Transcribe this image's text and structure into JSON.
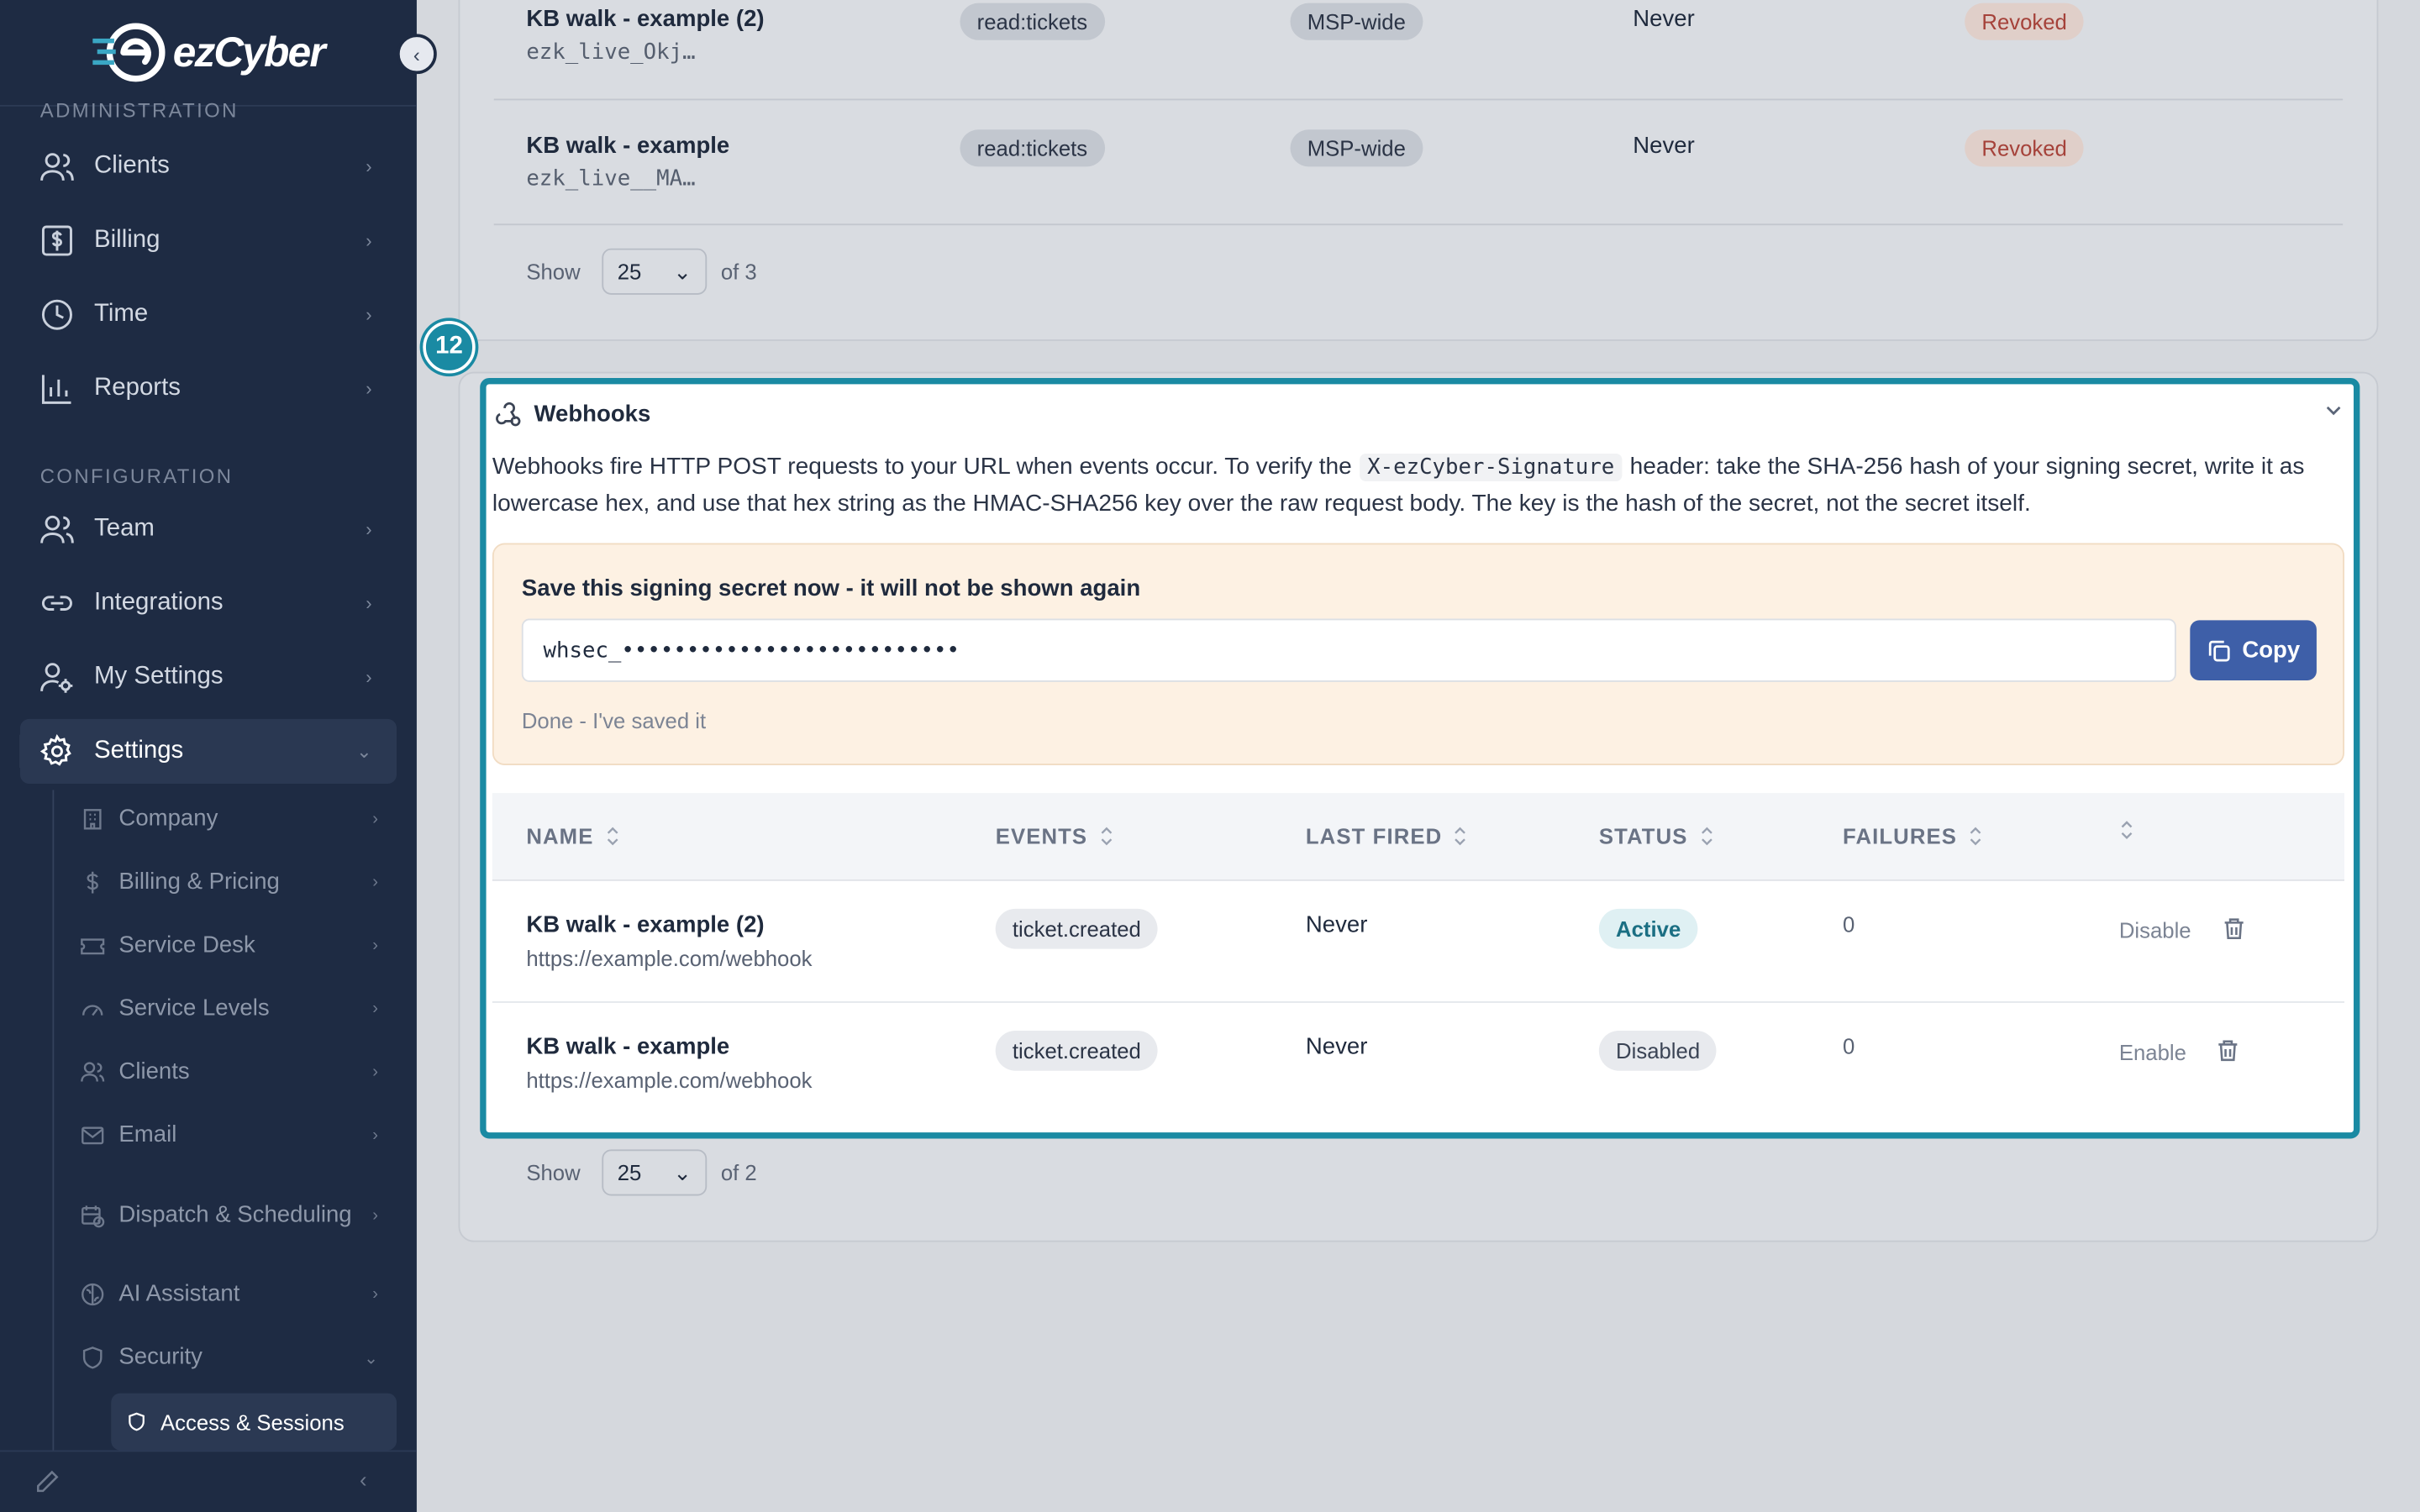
{
  "brand": {
    "name": "ezCyber"
  },
  "sidebar": {
    "section_admin": "ADMINISTRATION",
    "admin_items": [
      {
        "label": "Clients"
      },
      {
        "label": "Billing"
      },
      {
        "label": "Time"
      },
      {
        "label": "Reports"
      }
    ],
    "section_config": "CONFIGURATION",
    "config_items": [
      {
        "label": "Team"
      },
      {
        "label": "Integrations"
      },
      {
        "label": "My Settings"
      },
      {
        "label": "Settings"
      }
    ],
    "settings_sub": [
      {
        "label": "Company"
      },
      {
        "label": "Billing & Pricing"
      },
      {
        "label": "Service Desk"
      },
      {
        "label": "Service Levels"
      },
      {
        "label": "Clients"
      },
      {
        "label": "Email"
      },
      {
        "label": "Dispatch & Scheduling"
      },
      {
        "label": "AI Assistant"
      },
      {
        "label": "Security"
      }
    ],
    "security_sub_active": "Access & Sessions"
  },
  "api_keys": {
    "rows": [
      {
        "name": "KB walk - example (2)",
        "key": "ezk_live_Okj…",
        "scope": "read:tickets",
        "reach": "MSP-wide",
        "last_used": "Never",
        "status": "Revoked"
      },
      {
        "name": "KB walk - example",
        "key": "ezk_live__MA…",
        "scope": "read:tickets",
        "reach": "MSP-wide",
        "last_used": "Never",
        "status": "Revoked"
      }
    ],
    "pager": {
      "show": "Show",
      "size": "25",
      "of": "of 3"
    }
  },
  "step_badge": "12",
  "webhooks": {
    "title": "Webhooks",
    "desc_1": "Webhooks fire HTTP POST requests to your URL when events occur. To verify the",
    "desc_code": "X-ezCyber-Signature",
    "desc_2": "header: take the SHA-256 hash of your signing secret, write it as lowercase hex, and use that hex string as the HMAC-SHA256 key over the raw request body. The key is the hash of the secret, not the secret itself.",
    "secret": {
      "title": "Save this signing secret now - it will not be shown again",
      "value": "whsec_••••••••••••••••••••••••••",
      "copy_label": "Copy",
      "done_label": "Done - I've saved it"
    },
    "columns": [
      "NAME",
      "EVENTS",
      "LAST FIRED",
      "STATUS",
      "FAILURES"
    ],
    "rows": [
      {
        "name": "KB walk - example (2)",
        "url": "https://example.com/webhook",
        "event": "ticket.created",
        "last_fired": "Never",
        "status": "Active",
        "failures": "0",
        "action": "Disable"
      },
      {
        "name": "KB walk - example",
        "url": "https://example.com/webhook",
        "event": "ticket.created",
        "last_fired": "Never",
        "status": "Disabled",
        "failures": "0",
        "action": "Enable"
      }
    ],
    "pager": {
      "show": "Show",
      "size": "25",
      "of": "of 2"
    }
  }
}
